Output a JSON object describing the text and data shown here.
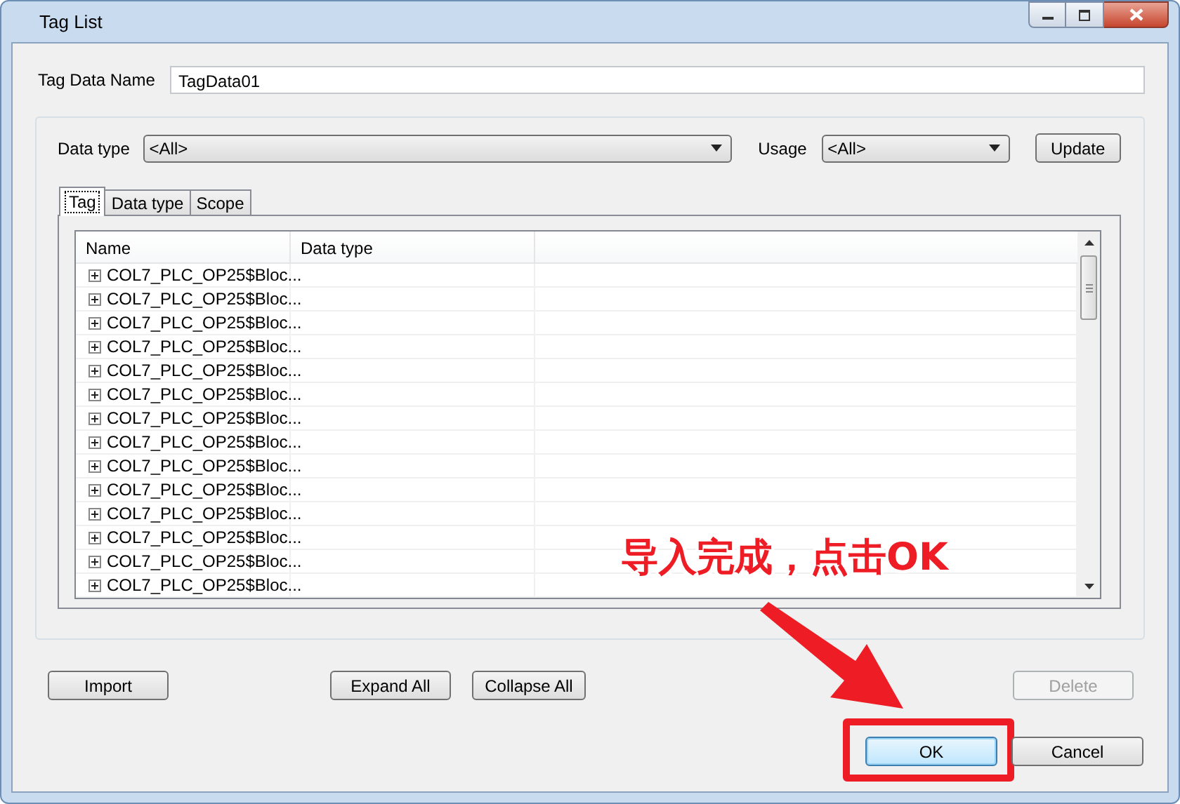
{
  "window": {
    "title": "Tag List"
  },
  "tag_data_name": {
    "label": "Tag Data Name",
    "value": "TagData01"
  },
  "filters": {
    "data_type": {
      "label": "Data type",
      "value": "<All>"
    },
    "usage": {
      "label": "Usage",
      "value": "<All>"
    },
    "update_button": "Update"
  },
  "tabs": [
    {
      "label": "Tag",
      "selected": true
    },
    {
      "label": "Data type",
      "selected": false
    },
    {
      "label": "Scope",
      "selected": false
    }
  ],
  "table": {
    "columns": [
      "Name",
      "Data type"
    ],
    "rows": [
      {
        "name": "COL7_PLC_OP25$Bloc...",
        "expanded": false
      },
      {
        "name": "COL7_PLC_OP25$Bloc...",
        "expanded": false
      },
      {
        "name": "COL7_PLC_OP25$Bloc...",
        "expanded": false
      },
      {
        "name": "COL7_PLC_OP25$Bloc...",
        "expanded": false
      },
      {
        "name": "COL7_PLC_OP25$Bloc...",
        "expanded": false
      },
      {
        "name": "COL7_PLC_OP25$Bloc...",
        "expanded": false
      },
      {
        "name": "COL7_PLC_OP25$Bloc...",
        "expanded": false
      },
      {
        "name": "COL7_PLC_OP25$Bloc...",
        "expanded": false
      },
      {
        "name": "COL7_PLC_OP25$Bloc...",
        "expanded": false
      },
      {
        "name": "COL7_PLC_OP25$Bloc...",
        "expanded": false
      },
      {
        "name": "COL7_PLC_OP25$Bloc...",
        "expanded": false
      },
      {
        "name": "COL7_PLC_OP25$Bloc...",
        "expanded": false
      },
      {
        "name": "COL7_PLC_OP25$Bloc...",
        "expanded": false
      },
      {
        "name": "COL7_PLC_OP25$Bloc...",
        "expanded": false
      }
    ]
  },
  "action_buttons": [
    {
      "label": "Import",
      "disabled": false
    },
    {
      "label": "Expand All",
      "disabled": false
    },
    {
      "label": "Collapse All",
      "disabled": false
    },
    {
      "label": "Delete",
      "disabled": true
    }
  ],
  "dialog_buttons": [
    {
      "label": "OK",
      "default": true,
      "highlighted": true
    },
    {
      "label": "Cancel",
      "default": false,
      "highlighted": false
    }
  ],
  "annotation": {
    "text": "导入完成，点击OK"
  }
}
